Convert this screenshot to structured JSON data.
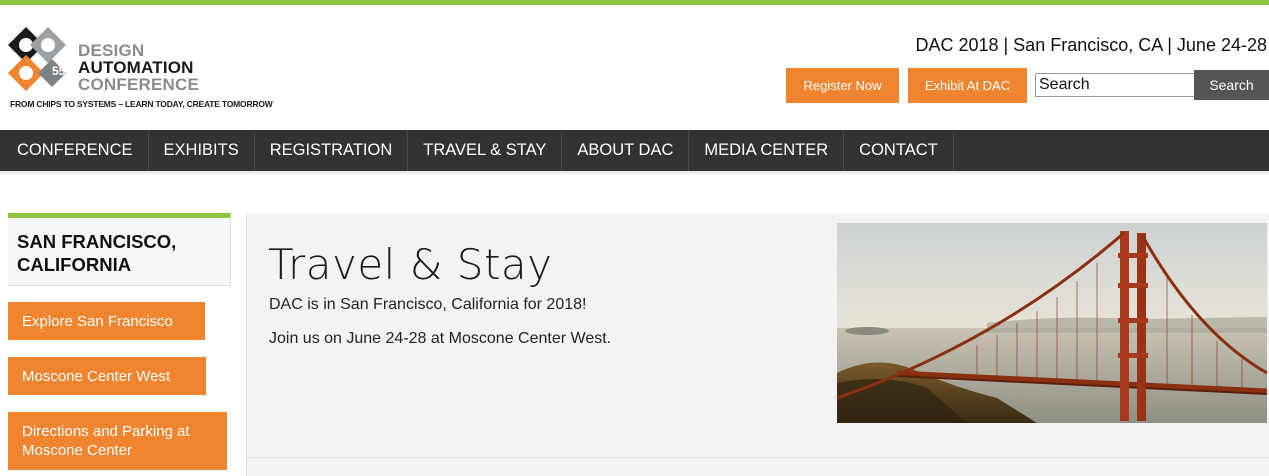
{
  "header": {
    "logo": {
      "line1": "DESIGN",
      "line2": "AUTOMATION",
      "line3": "CONFERENCE",
      "badge": "55",
      "tagline": "FROM CHIPS TO SYSTEMS – LEARN TODAY, CREATE TOMORROW"
    },
    "event_info": "DAC 2018 | San Francisco, CA | June 24-28",
    "register_label": "Register Now",
    "exhibit_label": "Exhibit At DAC",
    "search_placeholder": "Search",
    "search_button_label": "Search"
  },
  "nav": {
    "items": [
      {
        "label": "CONFERENCE"
      },
      {
        "label": "EXHIBITS"
      },
      {
        "label": "REGISTRATION"
      },
      {
        "label": "TRAVEL & STAY"
      },
      {
        "label": "ABOUT DAC"
      },
      {
        "label": "MEDIA CENTER"
      },
      {
        "label": "CONTACT"
      }
    ]
  },
  "sidebar": {
    "title_line1": "SAN FRANCISCO,",
    "title_line2": "CALIFORNIA",
    "links": [
      {
        "label": "Explore San Francisco"
      },
      {
        "label": "Moscone Center West"
      },
      {
        "label_line1": "Directions and Parking at",
        "label_line2": "Moscone Center"
      }
    ]
  },
  "main": {
    "title": "Travel & Stay",
    "intro_1": "DAC is in San Francisco, California for 2018!",
    "intro_2": "Join us on June 24-28 at Moscone Center West."
  },
  "colors": {
    "accent_green": "#8cc63f",
    "accent_orange": "#f0842f",
    "nav_bg": "#323232"
  }
}
